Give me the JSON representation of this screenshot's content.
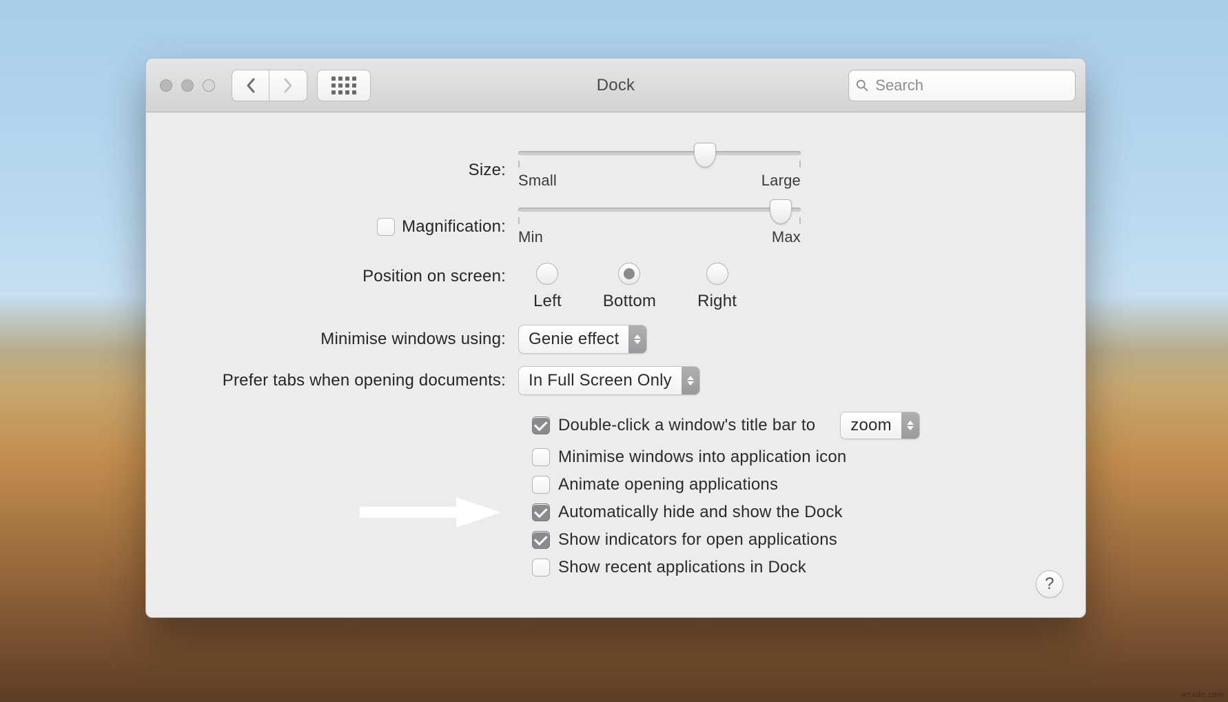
{
  "window_title": "Dock",
  "search_placeholder": "Search",
  "labels": {
    "size": "Size:",
    "magnification": "Magnification:",
    "position": "Position on screen:",
    "minimise": "Minimise windows using:",
    "prefer_tabs": "Prefer tabs when opening documents:"
  },
  "slider_size": {
    "min_label": "Small",
    "max_label": "Large",
    "value_percent": 66
  },
  "slider_mag": {
    "min_label": "Min",
    "max_label": "Max",
    "value_percent": 93,
    "checked": false
  },
  "position": {
    "options": [
      "Left",
      "Bottom",
      "Right"
    ],
    "selected": "Bottom"
  },
  "minimise_effect": "Genie effect",
  "prefer_tabs_value": "In Full Screen Only",
  "options": {
    "double_click": {
      "checked": true,
      "label": "Double-click a window's title bar to",
      "value": "zoom"
    },
    "minimise_into_icon": {
      "checked": false,
      "label": "Minimise windows into application icon"
    },
    "animate_opening": {
      "checked": false,
      "label": "Animate opening applications"
    },
    "auto_hide": {
      "checked": true,
      "label": "Automatically hide and show the Dock"
    },
    "indicators": {
      "checked": true,
      "label": "Show indicators for open applications"
    },
    "show_recent": {
      "checked": false,
      "label": "Show recent applications in Dock"
    }
  },
  "help_label": "?",
  "watermark": "wsxdn.com"
}
